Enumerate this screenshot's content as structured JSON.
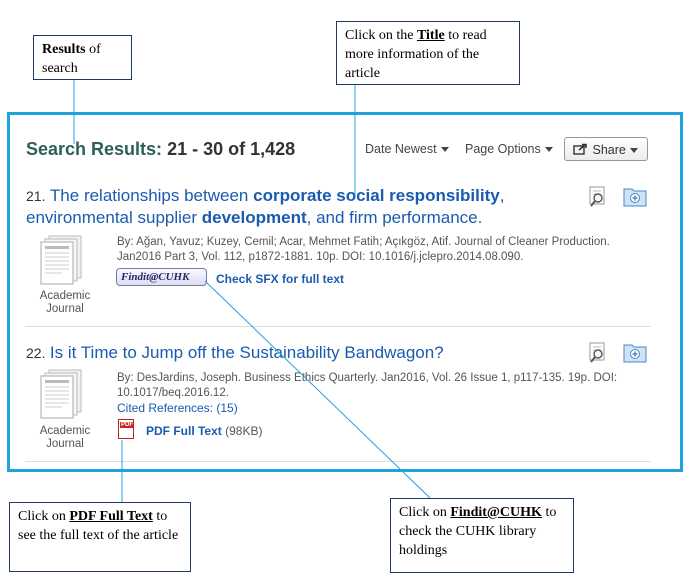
{
  "callouts": {
    "results": {
      "bold": "Results",
      "rest": " of search"
    },
    "title": {
      "prefix": "Click on the ",
      "bold": "Title",
      "rest": " to read more information  of the article"
    },
    "pdf": {
      "prefix": "Click on ",
      "bold": "PDF Full Text",
      "rest": " to see the full text of the article"
    },
    "findit": {
      "prefix": "Click on ",
      "bold": "Findit@CUHK",
      "rest": " to check the CUHK library holdings"
    }
  },
  "header": {
    "label": "Search Results:",
    "count": "21 - 30 of 1,428",
    "sort_label": "Date Newest",
    "page_options_label": "Page Options",
    "share_label": "Share"
  },
  "results": [
    {
      "number": "21.",
      "title_parts": [
        "The relationships between ",
        "corporate social responsibility",
        ", environmental supplier ",
        "development",
        ", and firm performance."
      ],
      "meta_line1": "By: Ağan, Yavuz; Kuzey, Cemil; Acar, Mehmet Fatih; Açıkgöz, Atif. Journal of Cleaner Production.",
      "meta_line2": "Jan2016 Part 3, Vol. 112, p1872-1881. 10p. DOI: 10.1016/j.jclepro.2014.08.090.",
      "findit_label": "Findit@CUHK",
      "sfx_label": "Check SFX for full text",
      "type_line1": "Academic",
      "type_line2": "Journal"
    },
    {
      "number": "22.",
      "title": "Is it Time to Jump off the Sustainability Bandwagon?",
      "meta_line1": "By: DesJardins, Joseph. Business Ethics Quarterly. Jan2016, Vol. 26 Issue 1, p117-135. 19p. DOI:",
      "meta_line2": "10.1017/beq.2016.12.",
      "cited_label": "Cited References:",
      "cited_count": "(15)",
      "pdf_label": "PDF Full Text",
      "pdf_size": "(98KB)",
      "pdf_icon_text": "PDF",
      "type_line1": "Academic",
      "type_line2": "Journal"
    }
  ],
  "icons": {
    "preview": "magnifier-preview-icon",
    "add_folder": "add-to-folder-icon",
    "share": "share-arrow-icon",
    "document": "academic-journal-document-icon",
    "pdf": "pdf-file-icon"
  },
  "colors": {
    "frame": "#1fa3dc",
    "link": "#1a5bb0",
    "heading": "#2e5e5a",
    "callout_border": "#1f3864"
  }
}
